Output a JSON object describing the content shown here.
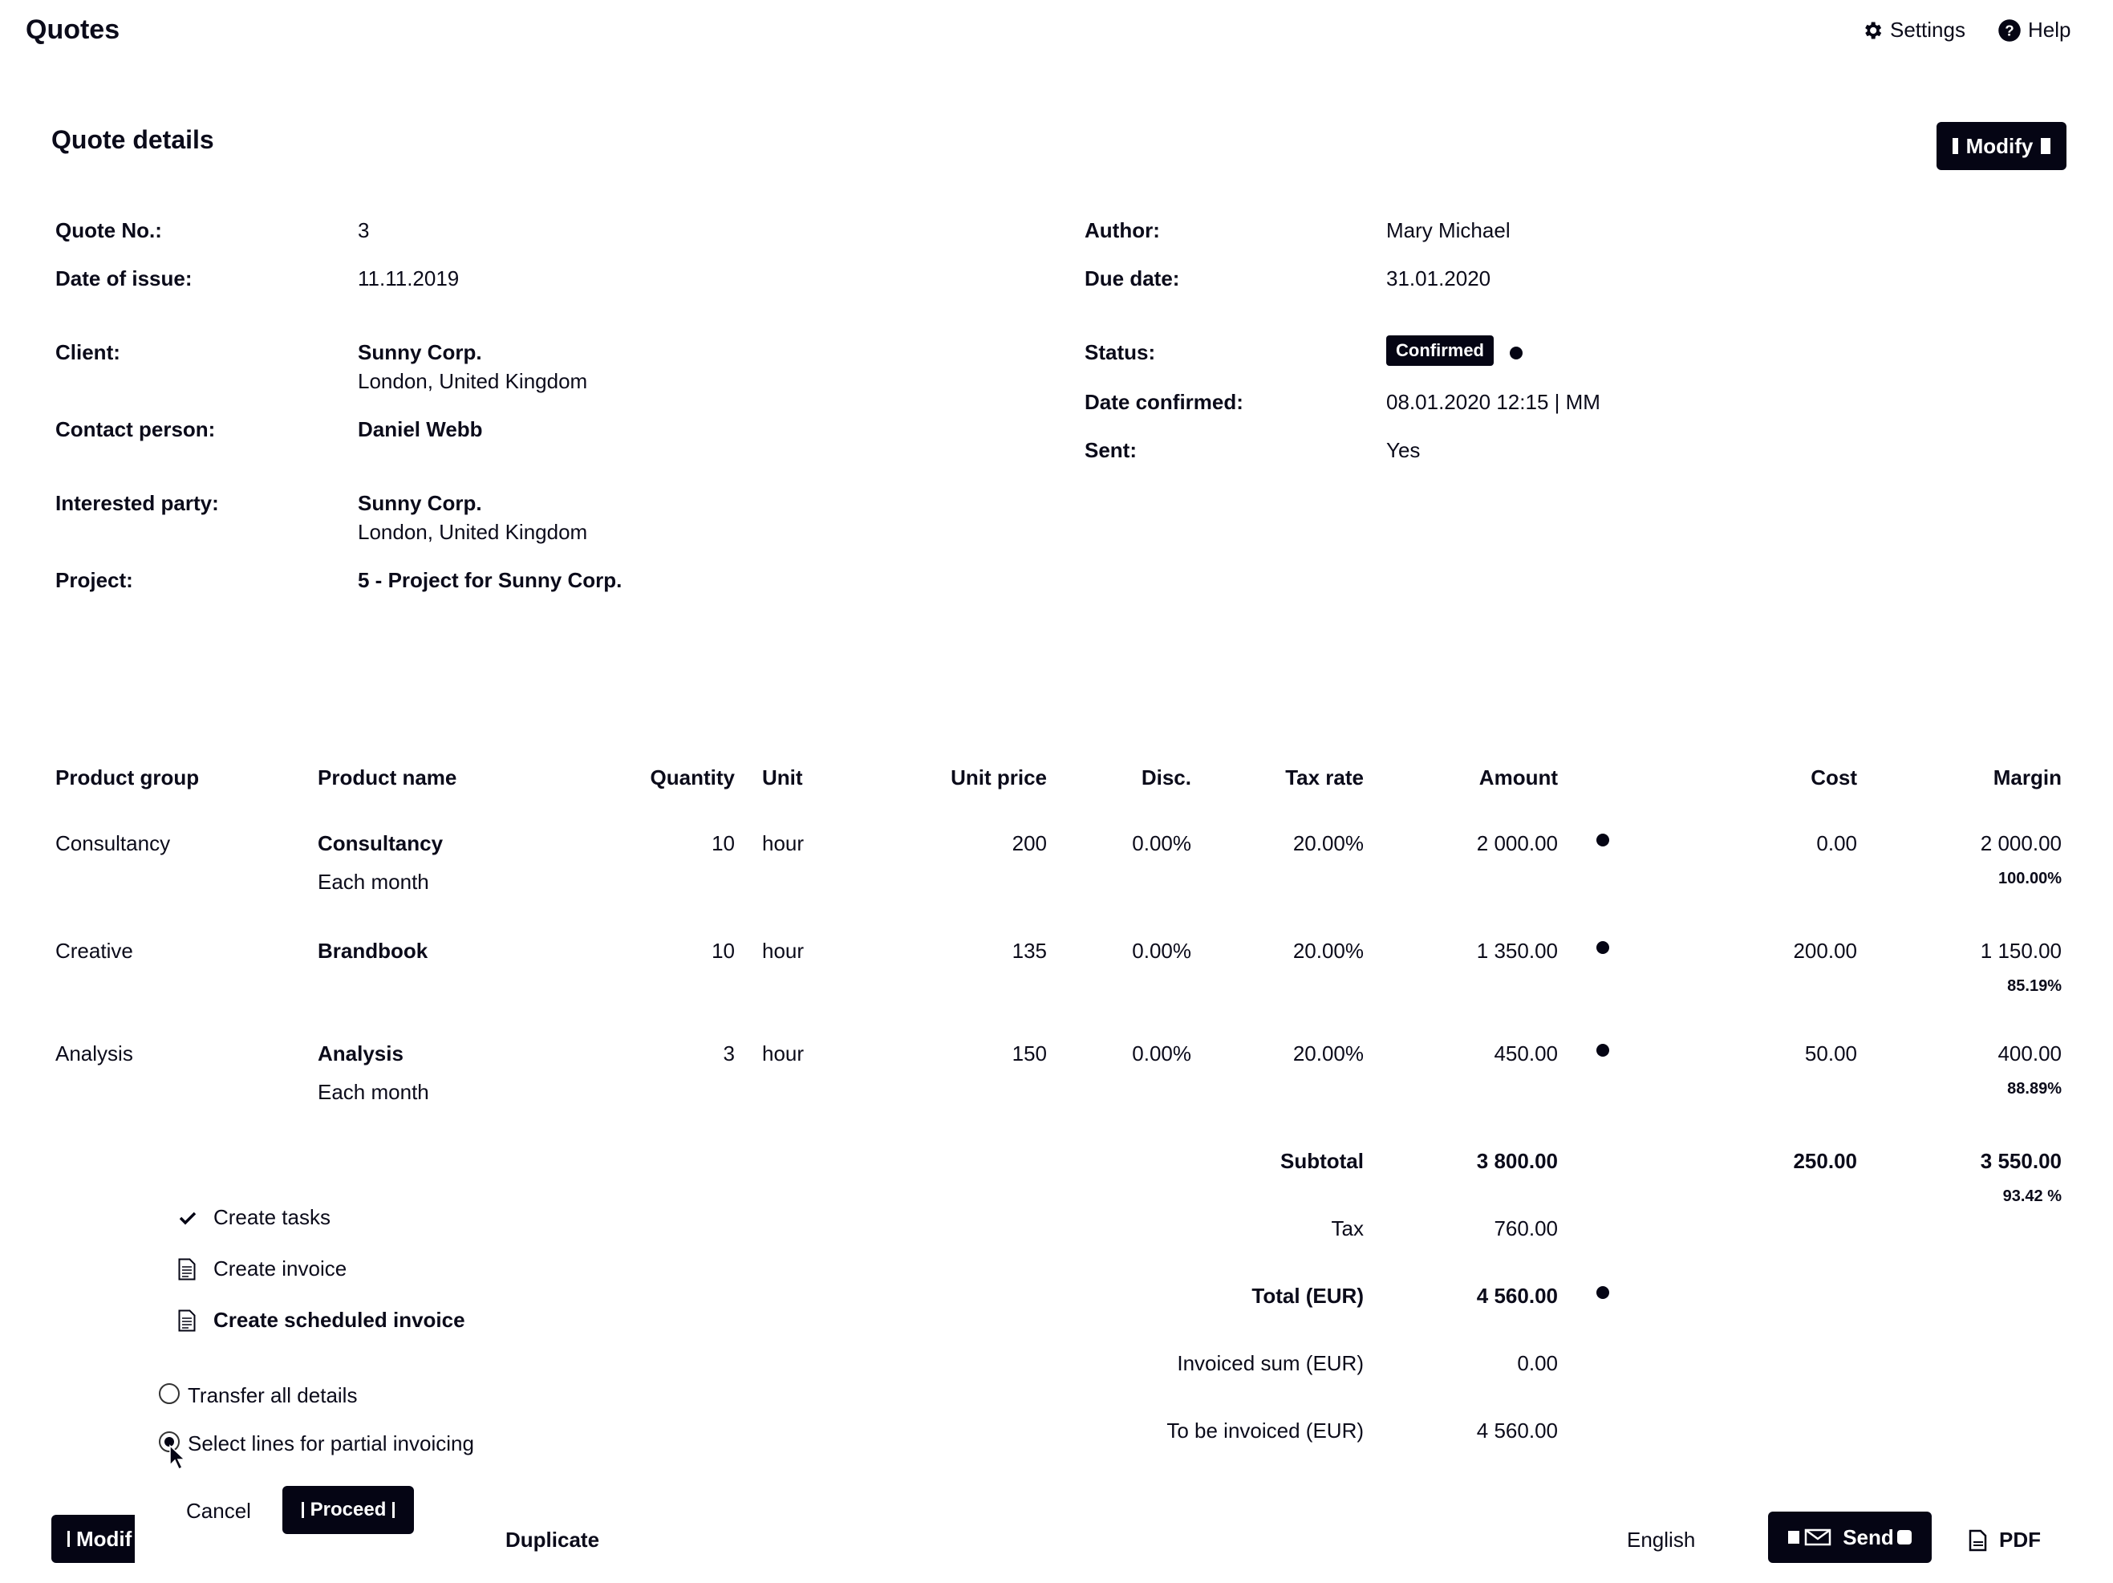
{
  "app": {
    "title": "Quotes",
    "settings_label": "Settings",
    "help_label": "Help"
  },
  "section": {
    "title": "Quote details",
    "modify_label": "Modify"
  },
  "details_left": [
    {
      "label": "Quote No.:",
      "value": "3"
    },
    {
      "label": "Date of issue:",
      "value": "11.11.2019"
    },
    {
      "label": "Client:",
      "value": "Sunny Corp.",
      "sub": "London, United Kingdom"
    },
    {
      "label": "Contact person:",
      "value": "Daniel Webb"
    },
    {
      "label": "Interested party:",
      "value": "Sunny Corp.",
      "sub": "London, United Kingdom"
    },
    {
      "label": "Project:",
      "value": "5 - Project for Sunny Corp."
    }
  ],
  "details_right": {
    "author_label": "Author:",
    "author": "Mary Michael",
    "due_label": "Due date:",
    "due": "31.01.2020",
    "status_label": "Status:",
    "status": "Confirmed",
    "confirmed_label": "Date confirmed:",
    "confirmed": "08.01.2020 12:15 | MM",
    "sent_label": "Sent:",
    "sent": "Yes"
  },
  "table": {
    "headers": [
      "Product group",
      "Product name",
      "Quantity",
      "Unit",
      "Unit price",
      "Disc.",
      "Tax rate",
      "Amount",
      "Cost",
      "Margin"
    ],
    "rows": [
      {
        "group": "Consultancy",
        "name": "Consultancy",
        "note": "Each month",
        "qty": "10",
        "unit": "hour",
        "price": "200",
        "disc": "0.00%",
        "tax": "20.00%",
        "amount": "2 000.00",
        "cost": "0.00",
        "margin": "2 000.00",
        "margin_pct": "100.00%"
      },
      {
        "group": "Creative",
        "name": "Brandbook",
        "note": "",
        "qty": "10",
        "unit": "hour",
        "price": "135",
        "disc": "0.00%",
        "tax": "20.00%",
        "amount": "1 350.00",
        "cost": "200.00",
        "margin": "1 150.00",
        "margin_pct": "85.19%"
      },
      {
        "group": "Analysis",
        "name": "Analysis",
        "note": "Each month",
        "qty": "3",
        "unit": "hour",
        "price": "150",
        "disc": "0.00%",
        "tax": "20.00%",
        "amount": "450.00",
        "cost": "50.00",
        "margin": "400.00",
        "margin_pct": "88.89%"
      }
    ]
  },
  "totals": {
    "subtotal_label": "Subtotal",
    "subtotal": "3 800.00",
    "subtotal_cost": "250.00",
    "subtotal_margin": "3 550.00",
    "subtotal_margin_pct": "93.42 %",
    "tax_label": "Tax",
    "tax": "760.00",
    "total_label": "Total (EUR)",
    "total": "4 560.00",
    "invoiced_label": "Invoiced sum (EUR)",
    "invoiced": "0.00",
    "to_invoice_label": "To be invoiced (EUR)",
    "to_invoice": "4 560.00"
  },
  "popup": {
    "create_tasks": "Create tasks",
    "create_invoice": "Create invoice",
    "create_scheduled_invoice": "Create scheduled invoice",
    "transfer_all": "Transfer all details",
    "select_lines": "Select lines for partial invoicing",
    "cancel": "Cancel",
    "proceed": "Proceed"
  },
  "footer": {
    "modify_partial": "Modif",
    "duplicate": "Duplicate",
    "language": "English",
    "send": "Send",
    "pdf": "PDF"
  },
  "colors": {
    "dark": "#050514",
    "text": "#0b0b1a"
  }
}
